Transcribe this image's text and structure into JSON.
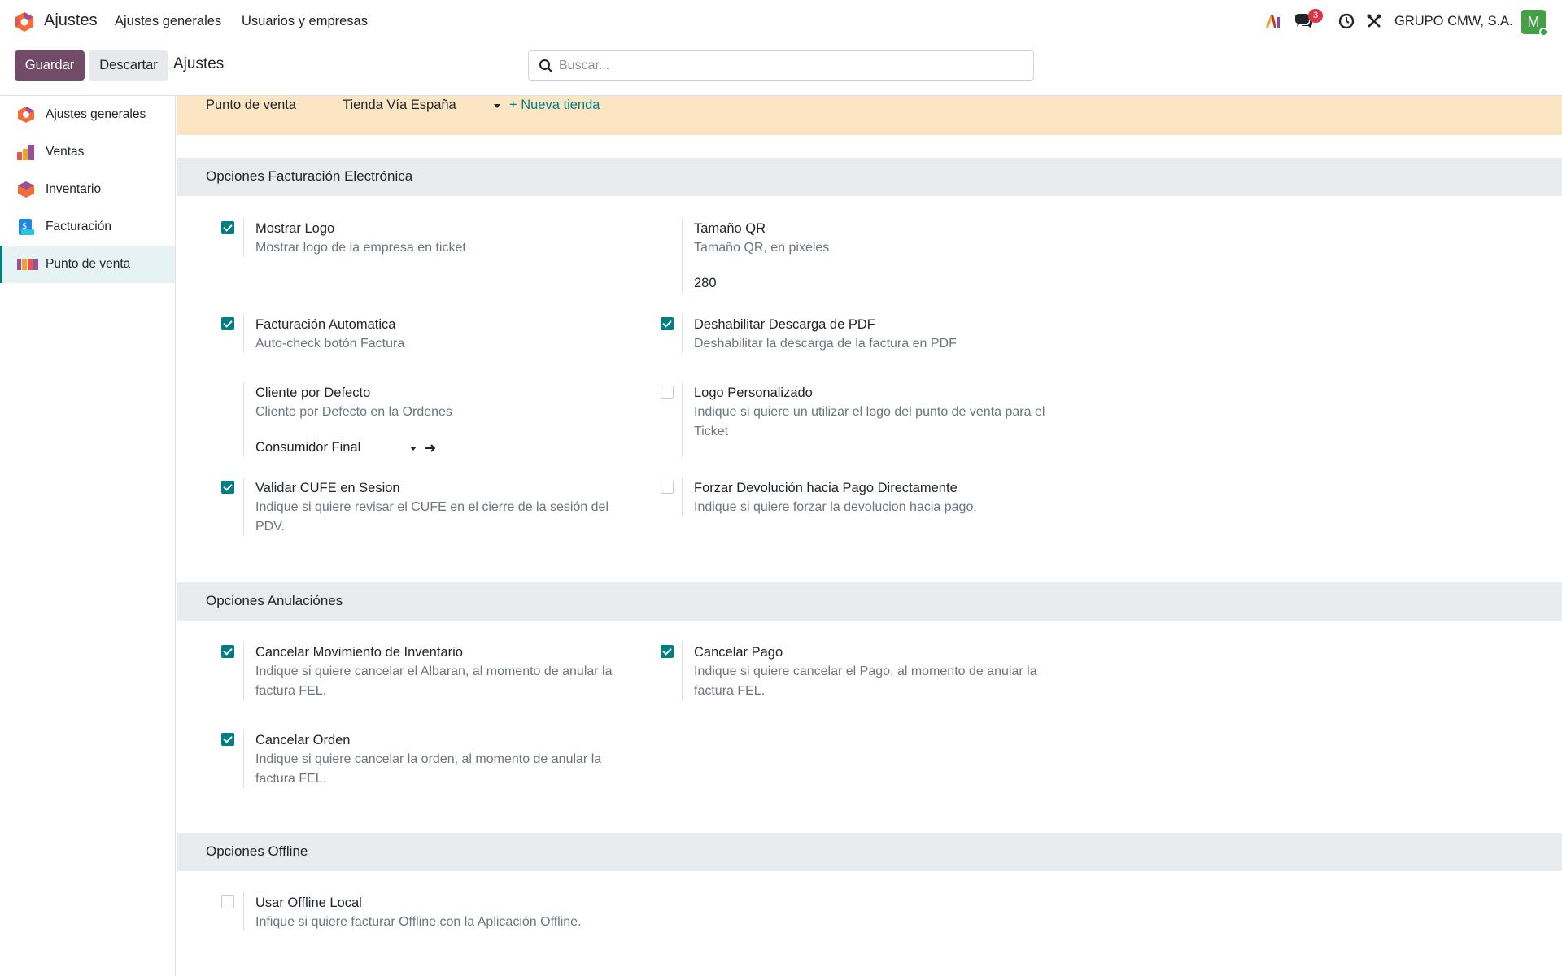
{
  "topbar": {
    "app_name": "Ajustes",
    "menu": [
      "Ajustes generales",
      "Usuarios y empresas"
    ],
    "messages_count": "3",
    "company": "GRUPO CMW, S.A.",
    "avatar_letter": "M",
    "icons": [
      "ai-icon",
      "chat-icon",
      "clock-icon",
      "tools-icon"
    ]
  },
  "control": {
    "save_label": "Guardar",
    "discard_label": "Descartar",
    "title": "Ajustes",
    "search_placeholder": "Buscar..."
  },
  "sidebar": {
    "items": [
      {
        "label": "Ajustes generales",
        "icon": "settings-app-icon"
      },
      {
        "label": "Ventas",
        "icon": "sales-app-icon"
      },
      {
        "label": "Inventario",
        "icon": "inventory-app-icon"
      },
      {
        "label": "Facturación",
        "icon": "invoicing-app-icon"
      },
      {
        "label": "Punto de venta",
        "icon": "pos-app-icon",
        "active": true
      }
    ]
  },
  "store": {
    "label": "Punto de venta",
    "selected": "Tienda Vía España",
    "new_label": "+ Nueva tienda"
  },
  "sections": {
    "fel": {
      "title": "Opciones Facturación Electrónica",
      "mostrar_logo": {
        "title": "Mostrar Logo",
        "desc": "Mostrar logo de la empresa en ticket",
        "checked": true
      },
      "tamano_qr": {
        "title": "Tamaño QR",
        "desc": "Tamaño QR, en pixeles.",
        "value": "280"
      },
      "facturacion_auto": {
        "title": "Facturación Automatica",
        "desc": "Auto-check botón Factura",
        "checked": true
      },
      "deshabilitar_pdf": {
        "title": "Deshabilitar Descarga de PDF",
        "desc": "Deshabilitar la descarga de la factura en PDF",
        "checked": true
      },
      "cliente_defecto": {
        "title": "Cliente por Defecto",
        "desc": "Cliente por Defecto en la Ordenes",
        "value": "Consumidor Final"
      },
      "logo_personalizado": {
        "title": "Logo Personalizado",
        "desc": "Indique si quiere un utilizar el logo del punto de venta para el Ticket",
        "checked": false
      },
      "validar_cufe": {
        "title": "Validar CUFE en Sesion",
        "desc": "Indique si quiere revisar el CUFE en el cierre de la sesión del PDV.",
        "checked": true
      },
      "forzar_devolucion": {
        "title": "Forzar Devolución hacia Pago Directamente",
        "desc": "Indique si quiere forzar la devolucion hacia pago.",
        "checked": false
      }
    },
    "anulaciones": {
      "title": "Opciones Anulaciónes",
      "cancelar_inventario": {
        "title": "Cancelar Movimiento de Inventario",
        "desc": "Indique si quiere cancelar el Albaran, al momento de anular la factura FEL.",
        "checked": true
      },
      "cancelar_pago": {
        "title": "Cancelar Pago",
        "desc": "Indique si quiere cancelar el Pago, al momento de anular la factura FEL.",
        "checked": true
      },
      "cancelar_orden": {
        "title": "Cancelar Orden",
        "desc": "Indique si quiere cancelar la orden, al momento de anular la factura FEL.",
        "checked": true
      }
    },
    "offline": {
      "title": "Opciones Offline",
      "usar_offline": {
        "title": "Usar Offline Local",
        "desc": "Infique si quiere facturar Offline con la Aplicación Offline.",
        "checked": false
      }
    }
  },
  "colors": {
    "primary": "#714b67",
    "accent": "#017e84",
    "warning_band": "#fbe5c3",
    "section_bg": "#e9ecef"
  }
}
